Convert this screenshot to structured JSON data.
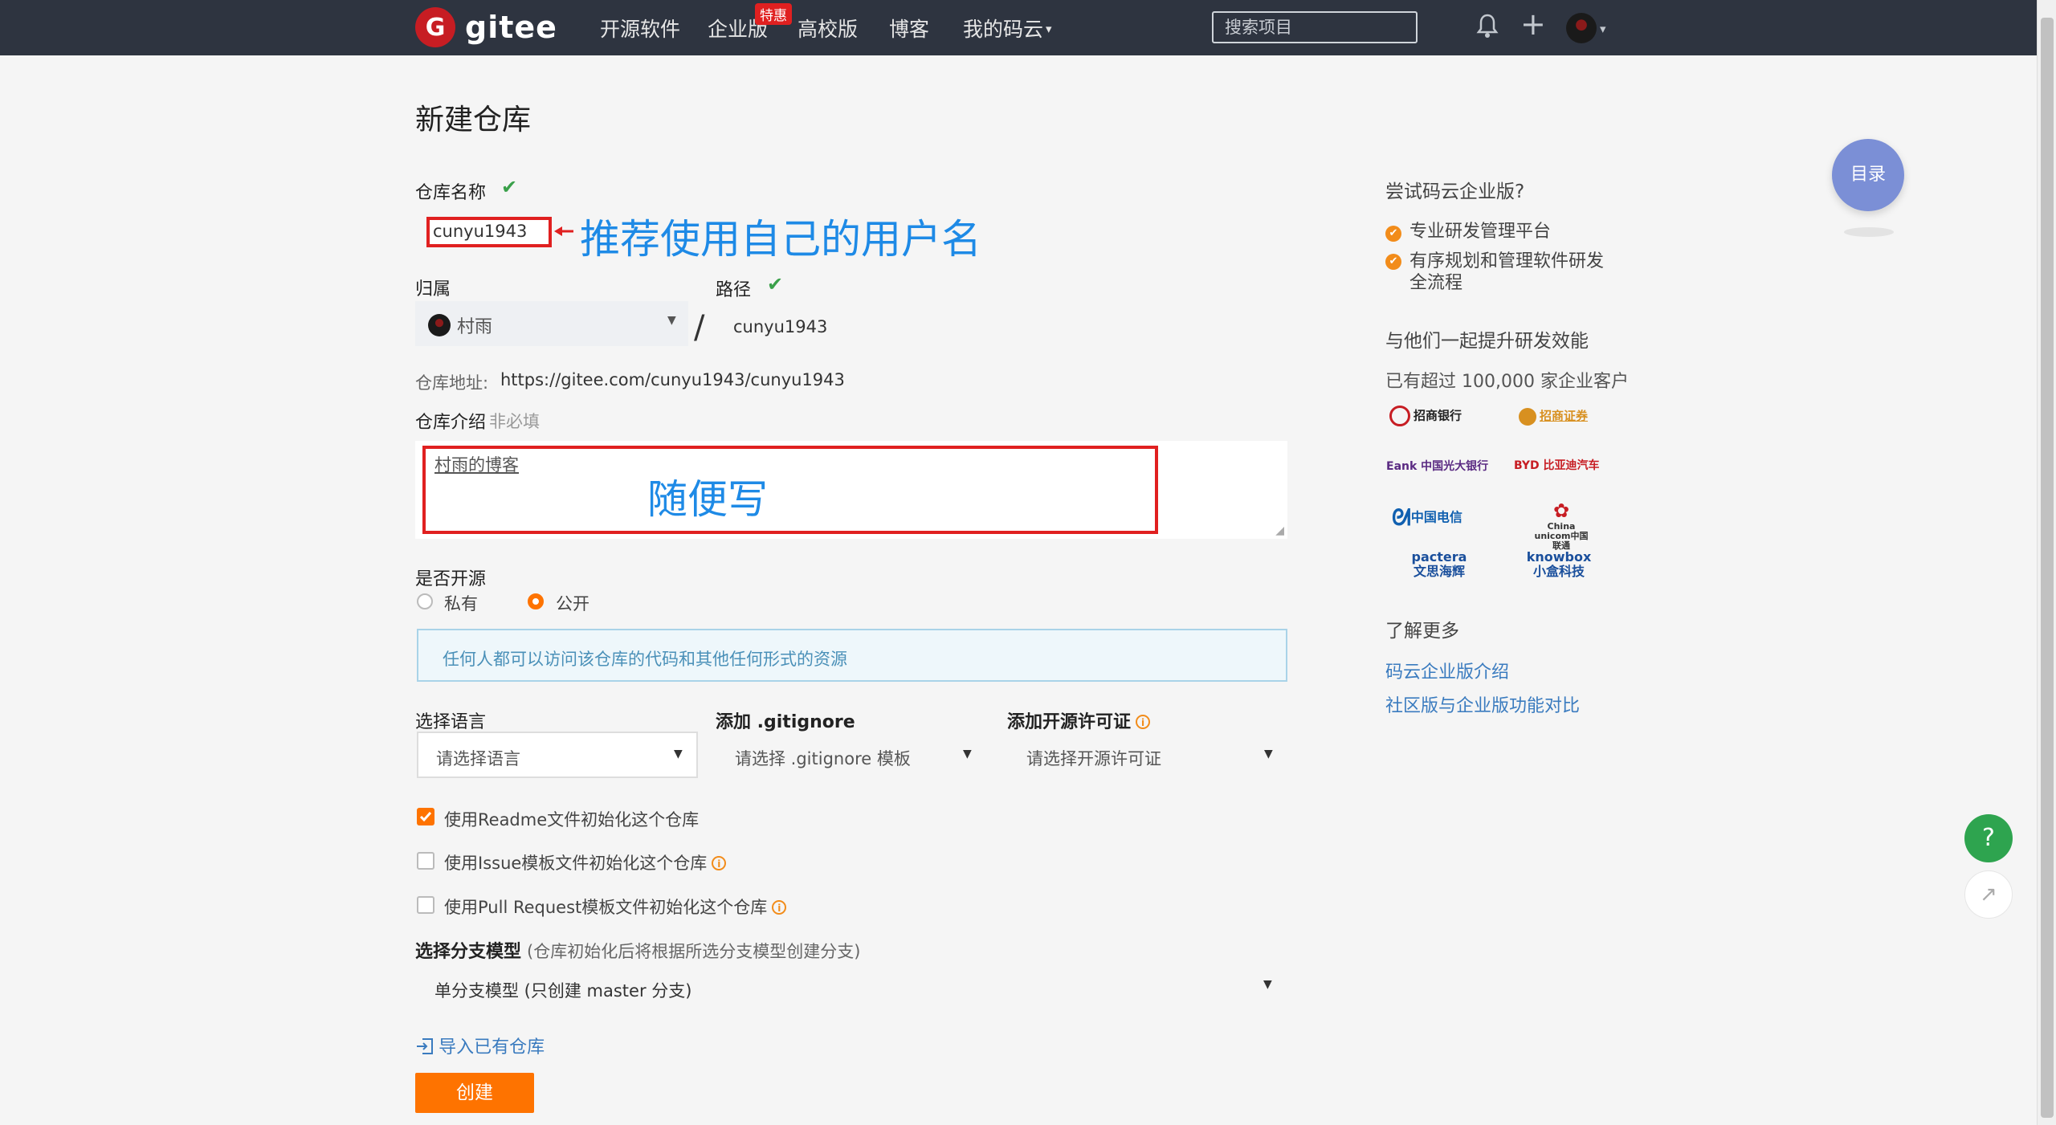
{
  "header": {
    "logo_mark": "G",
    "logo_text": "gitee",
    "nav": [
      "开源软件",
      "企业版",
      "高校版",
      "博客",
      "我的码云"
    ],
    "hot_badge": "特惠",
    "search_placeholder": "搜索项目",
    "bell_glyph": "🔔",
    "plus_glyph": "+",
    "caret": "▾"
  },
  "page": {
    "title": "新建仓库"
  },
  "form": {
    "repo_name_label": "仓库名称",
    "repo_name_value": "cunyu1943",
    "repo_name_annotation": "推荐使用自己的用户名",
    "owner_label": "归属",
    "owner_value": "村雨",
    "path_label": "路径",
    "path_value": "cunyu1943",
    "slash": "/",
    "repo_url_label": "仓库地址:",
    "repo_url_value": "https://gitee.com/cunyu1943/cunyu1943",
    "intro_label": "仓库介绍",
    "intro_optional": "非必填",
    "intro_value": "村雨的博客",
    "intro_annotation": "随便写",
    "open_label": "是否开源",
    "private_label": "私有",
    "public_label": "公开",
    "public_notice": "任何人都可以访问该仓库的代码和其他任何形式的资源",
    "language_label": "选择语言",
    "language_placeholder": "请选择语言",
    "gitignore_label": "添加 .gitignore",
    "gitignore_placeholder": "请选择 .gitignore 模板",
    "license_label": "添加开源许可证",
    "license_placeholder": "请选择开源许可证",
    "readme_label": "使用Readme文件初始化这个仓库",
    "issue_label": "使用Issue模板文件初始化这个仓库",
    "pr_label": "使用Pull Request模板文件初始化这个仓库",
    "branch_label": "选择分支模型",
    "branch_hint": "(仓库初始化后将根据所选分支模型创建分支)",
    "branch_value": "单分支模型 (只创建 master 分支)",
    "import_label": "导入已有仓库",
    "create_button": "创建",
    "info_glyph": "i"
  },
  "sidebar": {
    "try_title": "尝试码云企业版?",
    "features": [
      "专业研发管理平台",
      "有序规划和管理软件研发全流程"
    ],
    "together_title": "与他们一起提升研发效能",
    "customers_text": "已有超过 100,000 家企业客户",
    "logos": [
      "招商银行",
      "招商证券",
      "Eank 中国光大银行",
      "BYD 比亚迪汽车",
      "中国电信",
      "China unicom中国联通",
      "pactera 文思海辉",
      "knowbox 小盒科技"
    ],
    "learn_title": "了解更多",
    "links": [
      "码云企业版介绍",
      "社区版与企业版功能对比"
    ]
  },
  "floating": {
    "toc_label": "目录",
    "help_label": "?",
    "edit_glyph": "↗"
  },
  "colors": {
    "topbar": "#2e3440",
    "brand_red": "#c71d23",
    "accent_orange": "#fe7300",
    "check_green": "#3aa04a",
    "annotation_blue": "#1e8ae6",
    "annotation_red": "#e02020"
  }
}
